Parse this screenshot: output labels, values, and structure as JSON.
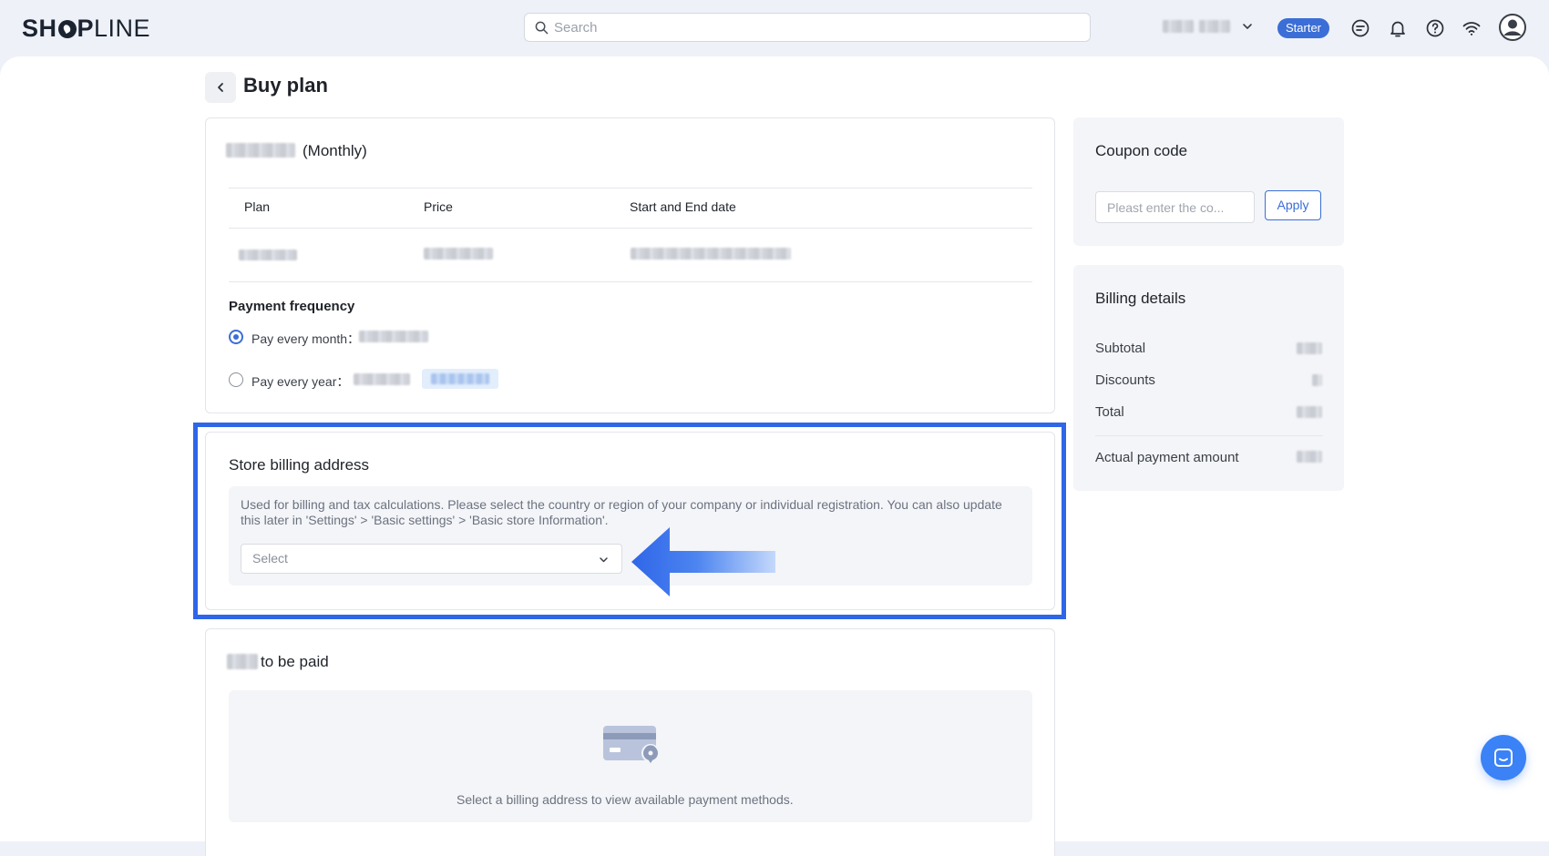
{
  "brand": {
    "logo_left": "SH",
    "logo_mid": "P",
    "logo_right": "LINE"
  },
  "topbar": {
    "search_placeholder": "Search",
    "plan_badge": "Starter",
    "icons": [
      "search-icon",
      "chevron-down-icon",
      "chat-bubble-icon",
      "bell-icon",
      "help-icon",
      "wifi-icon",
      "user-avatar-icon"
    ]
  },
  "page": {
    "title": "Buy plan"
  },
  "plan_card": {
    "title_suffix": "(Monthly)",
    "columns": [
      "Plan",
      "Price",
      "Start and End date"
    ],
    "payment_frequency_label": "Payment frequency",
    "options": [
      {
        "label": "Pay every month：",
        "selected": true
      },
      {
        "label": "Pay every year：",
        "selected": false
      }
    ]
  },
  "billing_address": {
    "title": "Store billing address",
    "description": "Used for billing and tax calculations. Please select the country or region of your company or individual registration. You can also update this later in 'Settings' > 'Basic settings' > 'Basic store Information'.",
    "select_placeholder": "Select"
  },
  "payment_card": {
    "title_suffix": "to be paid",
    "empty_message": "Select a billing address to view available payment methods."
  },
  "coupon": {
    "title": "Coupon code",
    "input_placeholder": "Pleast enter the co...",
    "apply_label": "Apply"
  },
  "billing_details": {
    "title": "Billing details",
    "rows": [
      "Subtotal",
      "Discounts",
      "Total"
    ],
    "actual_label": "Actual payment amount"
  },
  "colors": {
    "accent": "#3b6ed6",
    "highlight": "#2f66e8",
    "chat": "#3b82f6"
  }
}
